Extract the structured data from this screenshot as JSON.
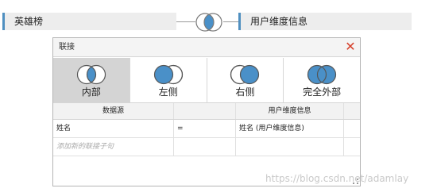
{
  "join_bar": {
    "left_table": "英雄榜",
    "right_table": "用户维度信息"
  },
  "dialog": {
    "title": "联接",
    "close_symbol": "✕",
    "join_types": [
      {
        "label": "内部",
        "icon": "inner-join-icon",
        "selected": true
      },
      {
        "label": "左侧",
        "icon": "left-join-icon",
        "selected": false
      },
      {
        "label": "右侧",
        "icon": "right-join-icon",
        "selected": false
      },
      {
        "label": "完全外部",
        "icon": "full-outer-join-icon",
        "selected": false
      }
    ],
    "grid": {
      "headers": [
        "数据源",
        "",
        "用户维度信息"
      ],
      "rows": [
        {
          "left": "姓名",
          "op": "=",
          "right": "姓名 (用户维度信息)"
        }
      ],
      "add_placeholder": "添加新的联接子句"
    }
  },
  "watermark": "https://blog.csdn.net/adamlay",
  "colors": {
    "accent": "#4f8fc0",
    "venn_fill": "#4a90c8",
    "selected_bg": "#d4d4d4",
    "close": "#d6402b"
  }
}
